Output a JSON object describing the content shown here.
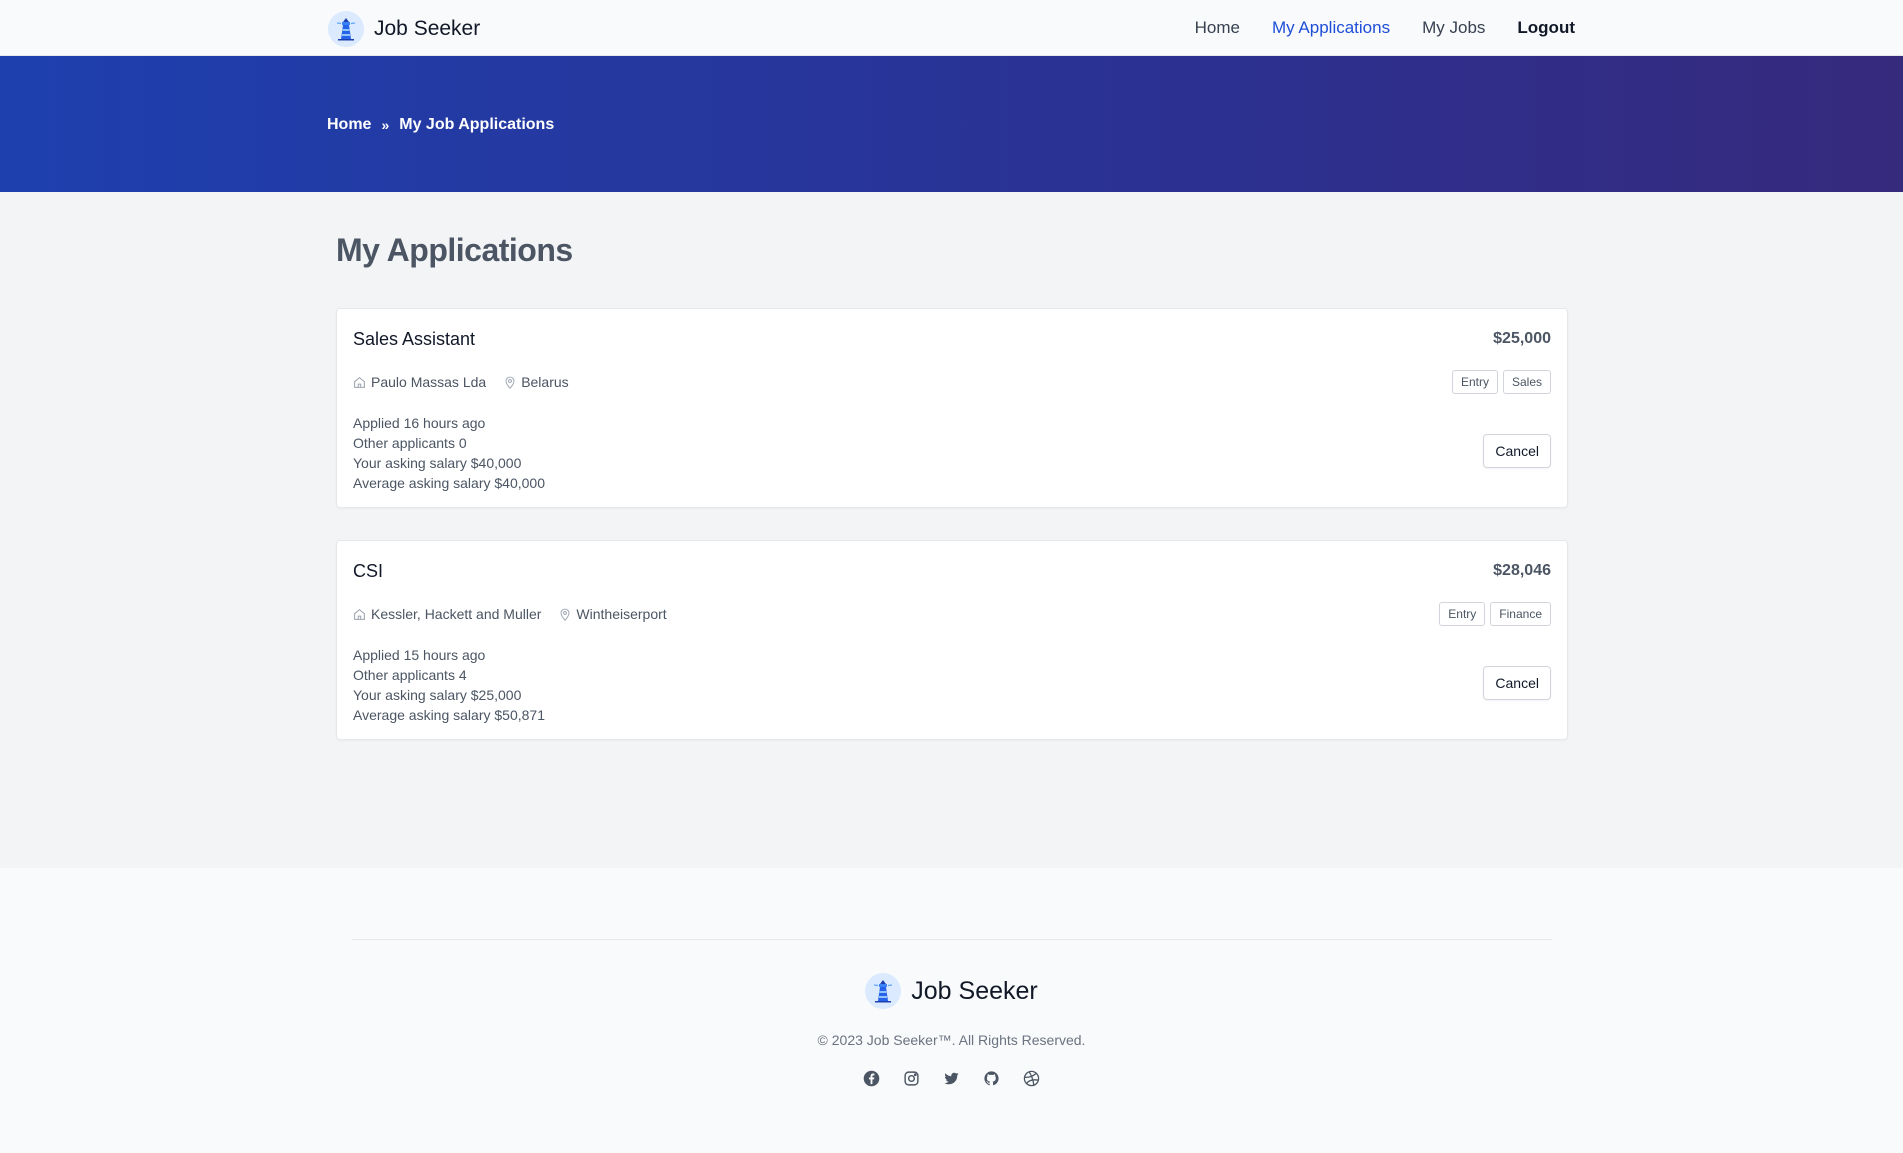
{
  "navbar": {
    "brand": "Job Seeker",
    "links": [
      {
        "label": "Home",
        "active": false
      },
      {
        "label": "My Applications",
        "active": true
      },
      {
        "label": "My Jobs",
        "active": false
      },
      {
        "label": "Logout",
        "active": false
      }
    ]
  },
  "hero": {
    "breadcrumb": {
      "home": "Home",
      "separator": "»",
      "current": "My Job Applications"
    }
  },
  "main": {
    "title": "My Applications",
    "applications": [
      {
        "title": "Sales Assistant",
        "salary": "$25,000",
        "company": "Paulo Massas Lda",
        "location": "Belarus",
        "tags": [
          "Entry",
          "Sales"
        ],
        "applied": "Applied 16 hours ago",
        "other_applicants": "Other applicants 0",
        "your_salary": "Your asking salary $40,000",
        "avg_salary": "Average asking salary $40,000",
        "cancel_label": "Cancel"
      },
      {
        "title": "CSI",
        "salary": "$28,046",
        "company": "Kessler, Hackett and Muller",
        "location": "Wintheiserport",
        "tags": [
          "Entry",
          "Finance"
        ],
        "applied": "Applied 15 hours ago",
        "other_applicants": "Other applicants 4",
        "your_salary": "Your asking salary $25,000",
        "avg_salary": "Average asking salary $50,871",
        "cancel_label": "Cancel"
      }
    ]
  },
  "footer": {
    "brand": "Job Seeker",
    "copyright": "© 2023 Job Seeker™. All Rights Reserved.",
    "socials": [
      "facebook-icon",
      "instagram-icon",
      "twitter-icon",
      "github-icon",
      "dribbble-icon"
    ]
  },
  "colors": {
    "primary": "#1d4ed8",
    "hero_start": "#1e40af",
    "hero_end": "#362a7d",
    "title_gray": "#4b5563"
  }
}
